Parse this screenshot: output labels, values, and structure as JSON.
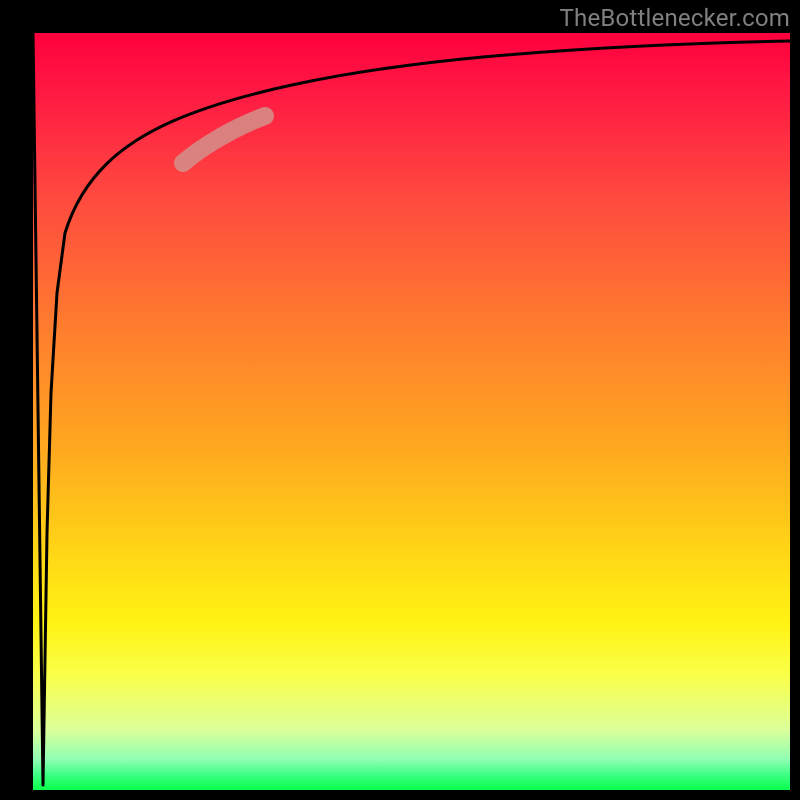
{
  "attribution": "TheBottlenecker.com",
  "chart_data": {
    "type": "line",
    "title": "",
    "xlabel": "",
    "ylabel": "",
    "xlim": [
      0,
      100
    ],
    "ylim": [
      0,
      100
    ],
    "grid": false,
    "legend": false,
    "gradient_stops": [
      {
        "pos": 0,
        "color": "#ff003e"
      },
      {
        "pos": 8,
        "color": "#ff1a43"
      },
      {
        "pos": 22,
        "color": "#ff4a3f"
      },
      {
        "pos": 38,
        "color": "#ff7a2f"
      },
      {
        "pos": 55,
        "color": "#ffa81f"
      },
      {
        "pos": 68,
        "color": "#ffd416"
      },
      {
        "pos": 78,
        "color": "#fff314"
      },
      {
        "pos": 85,
        "color": "#f9ff4a"
      },
      {
        "pos": 92,
        "color": "#dcff9a"
      },
      {
        "pos": 96,
        "color": "#8fffb4"
      },
      {
        "pos": 98,
        "color": "#3cff84"
      },
      {
        "pos": 100,
        "color": "#0aff4b"
      }
    ],
    "series": [
      {
        "name": "bottleneck-curve",
        "x": [
          0,
          1,
          2,
          3,
          4,
          5,
          6,
          8,
          10,
          13,
          17,
          22,
          28,
          35,
          45,
          55,
          68,
          82,
          100
        ],
        "y": [
          100,
          0,
          30,
          55,
          70,
          78,
          83,
          88,
          90,
          92,
          93.5,
          94.5,
          95.5,
          96.2,
          96.8,
          97.3,
          97.7,
          98.0,
          98.3
        ]
      }
    ],
    "highlight_segment": {
      "series": "bottleneck-curve",
      "x_range": [
        22,
        32
      ],
      "y_range": [
        85,
        90
      ],
      "color": "#d68b86"
    }
  }
}
